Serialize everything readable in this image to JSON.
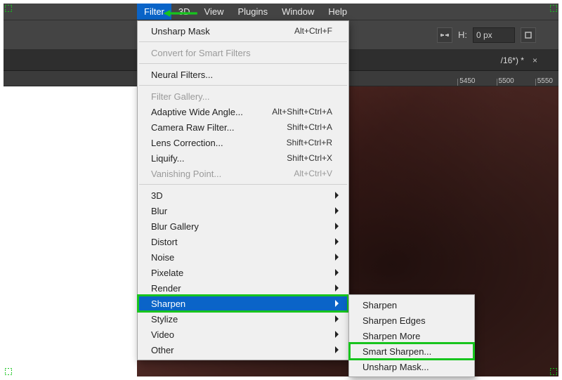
{
  "menubar": {
    "items": [
      "Filter",
      "3D",
      "View",
      "Plugins",
      "Window",
      "Help"
    ],
    "active_index": 0
  },
  "options_bar": {
    "h_label": "H:",
    "h_value": "0 px"
  },
  "doc_tab": {
    "suffix": "/16*) *"
  },
  "ruler_ticks": [
    "5450",
    "5500",
    "5550"
  ],
  "menu": {
    "recent": {
      "label": "Unsharp Mask",
      "shortcut": "Alt+Ctrl+F"
    },
    "convert": {
      "label": "Convert for Smart Filters"
    },
    "neural": {
      "label": "Neural Filters..."
    },
    "gallery": {
      "label": "Filter Gallery..."
    },
    "adaptive": {
      "label": "Adaptive Wide Angle...",
      "shortcut": "Alt+Shift+Ctrl+A"
    },
    "camera": {
      "label": "Camera Raw Filter...",
      "shortcut": "Shift+Ctrl+A"
    },
    "lens": {
      "label": "Lens Correction...",
      "shortcut": "Shift+Ctrl+R"
    },
    "liquify": {
      "label": "Liquify...",
      "shortcut": "Shift+Ctrl+X"
    },
    "vanishing": {
      "label": "Vanishing Point...",
      "shortcut": "Alt+Ctrl+V"
    },
    "sub_3d": "3D",
    "sub_blur": "Blur",
    "sub_blurgallery": "Blur Gallery",
    "sub_distort": "Distort",
    "sub_noise": "Noise",
    "sub_pixelate": "Pixelate",
    "sub_render": "Render",
    "sub_sharpen": "Sharpen",
    "sub_stylize": "Stylize",
    "sub_video": "Video",
    "sub_other": "Other"
  },
  "submenu_sharpen": {
    "sharpen": "Sharpen",
    "edges": "Sharpen Edges",
    "more": "Sharpen More",
    "smart": "Smart Sharpen...",
    "unsharp": "Unsharp Mask..."
  },
  "colors": {
    "highlight_green": "#17c41d",
    "selection_blue": "#0a64c8"
  }
}
